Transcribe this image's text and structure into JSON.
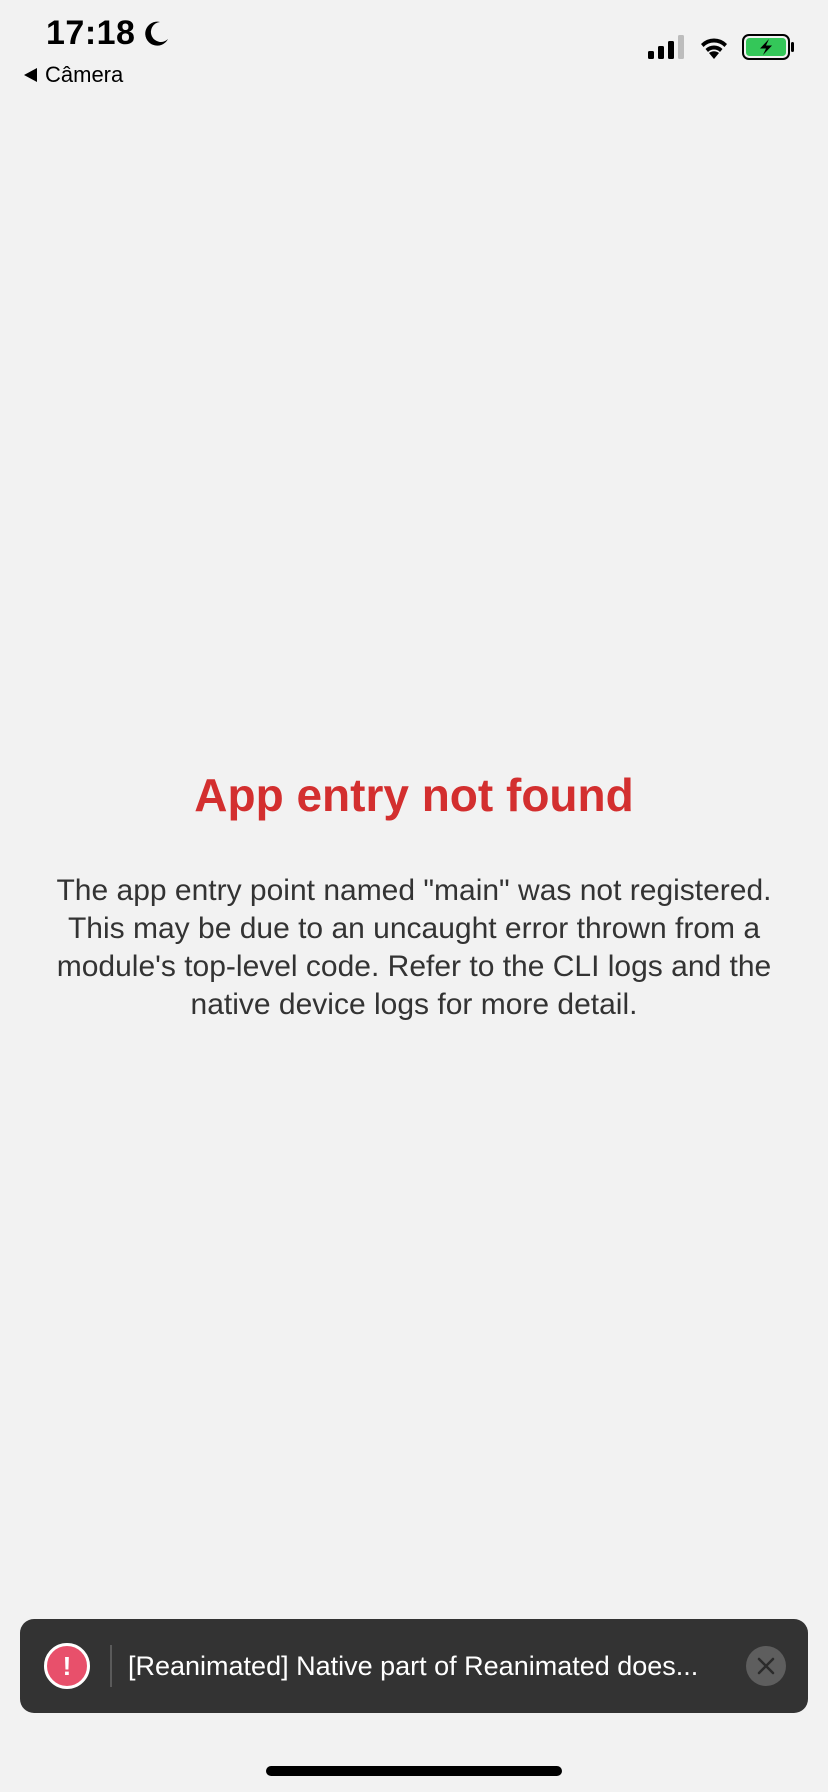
{
  "status_bar": {
    "time": "17:18",
    "back_app": "Câmera",
    "icons": [
      "moon-icon",
      "cellular-signal-icon",
      "wifi-icon",
      "battery-charging-icon"
    ],
    "battery_color": "#34c759"
  },
  "error": {
    "title": "App entry not found",
    "message": "The app entry point named \"main\" was not registered. This may be due to an uncaught error thrown from a module's top-level code. Refer to the CLI logs and the native device logs for more detail.",
    "title_color": "#d32f2f"
  },
  "toast": {
    "text": "[Reanimated] Native part of Reanimated does...",
    "error_icon_glyph": "!",
    "icons": [
      "error-icon",
      "close-icon"
    ],
    "accent": "#e8506b"
  },
  "colors": {
    "background": "#f2f2f2",
    "toast_background": "#333333"
  }
}
